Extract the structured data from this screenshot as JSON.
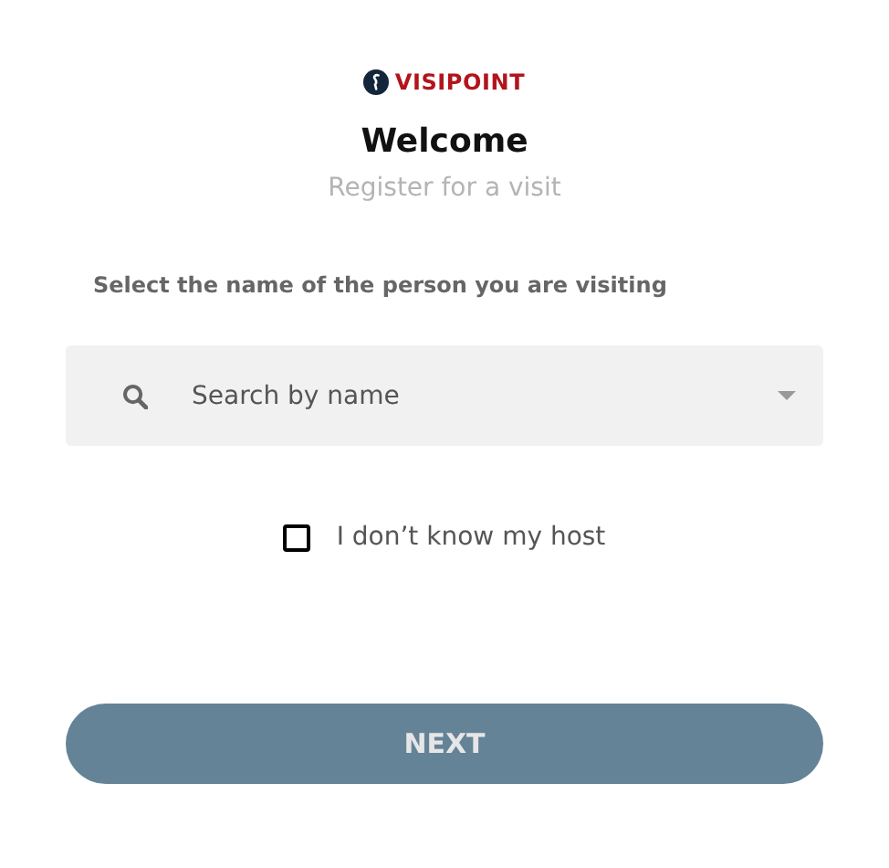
{
  "logo": {
    "text": "VISIPOINT"
  },
  "title": "Welcome",
  "subtitle": "Register for a visit",
  "prompt": "Select the name of the person you are visiting",
  "search": {
    "placeholder": "Search by name"
  },
  "host_checkbox": {
    "label": "I don’t know my host",
    "checked": false
  },
  "next_button": {
    "label": "NEXT",
    "disabled": true
  }
}
